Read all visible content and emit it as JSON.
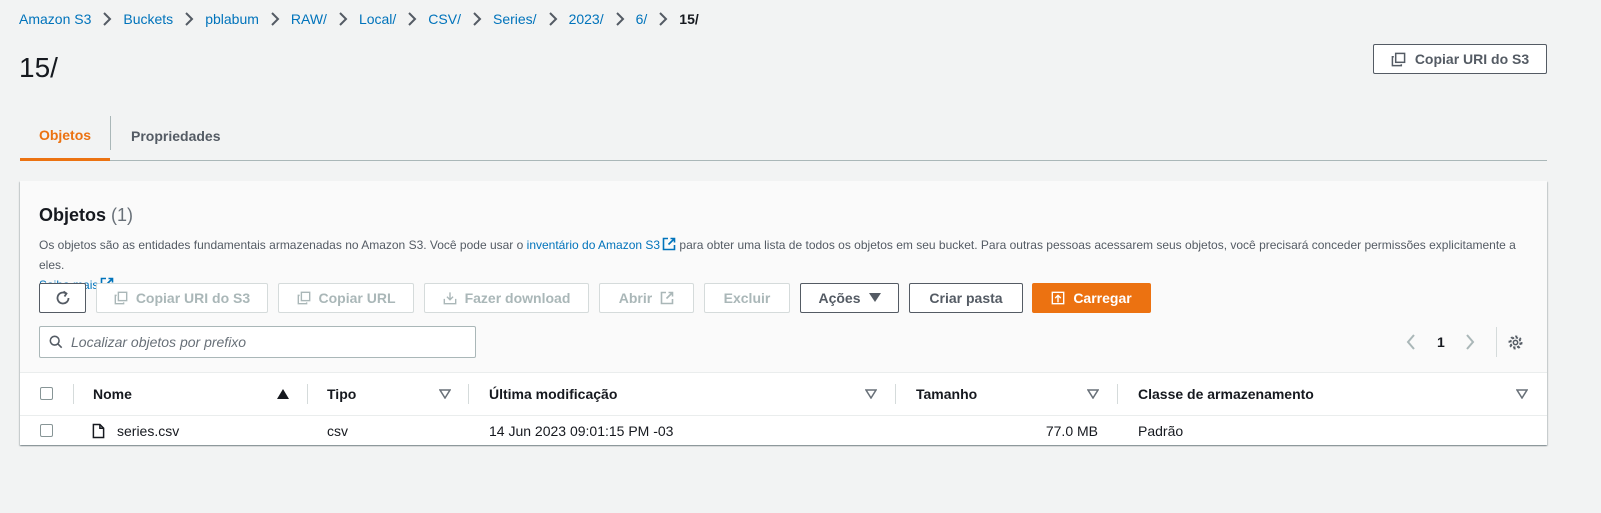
{
  "breadcrumb": {
    "items": [
      "Amazon S3",
      "Buckets",
      "pblabum",
      "RAW/",
      "Local/",
      "CSV/",
      "Series/",
      "2023/",
      "6/"
    ],
    "current": "15/"
  },
  "page": {
    "title": "15/",
    "copy_uri_label": "Copiar URI do S3"
  },
  "tabs": [
    {
      "label": "Objetos",
      "active": true
    },
    {
      "label": "Propriedades",
      "active": false
    }
  ],
  "objects_panel": {
    "title": "Objetos",
    "count": "(1)",
    "description_before": "Os objetos são as entidades fundamentais armazenadas no Amazon S3. Você pode usar o ",
    "inventory_link": "inventário do Amazon S3",
    "description_after": " para obter uma lista de todos os objetos em seu bucket. Para outras pessoas acessarem seus objetos, você precisará conceder permissões explicitamente a eles.",
    "learn_more": "Saiba mais"
  },
  "toolbar": {
    "refresh_icon": "refresh-icon",
    "copy_uri": "Copiar URI do S3",
    "copy_url": "Copiar URL",
    "download": "Fazer download",
    "open": "Abrir",
    "delete": "Excluir",
    "actions": "Ações",
    "create_folder": "Criar pasta",
    "upload": "Carregar"
  },
  "search": {
    "placeholder": "Localizar objetos por prefixo",
    "value": ""
  },
  "pagination": {
    "current_page": "1"
  },
  "table": {
    "columns": [
      "Nome",
      "Tipo",
      "Última modificação",
      "Tamanho",
      "Classe de armazenamento"
    ],
    "rows": [
      {
        "name": "series.csv",
        "type": "csv",
        "modified": "14 Jun 2023 09:01:15 PM -03",
        "size": "77.0 MB",
        "storage_class": "Padrão"
      }
    ]
  },
  "colors": {
    "accent": "#ec7211",
    "link": "#0073bb",
    "text": "#16191f",
    "background": "#f2f3f3"
  }
}
